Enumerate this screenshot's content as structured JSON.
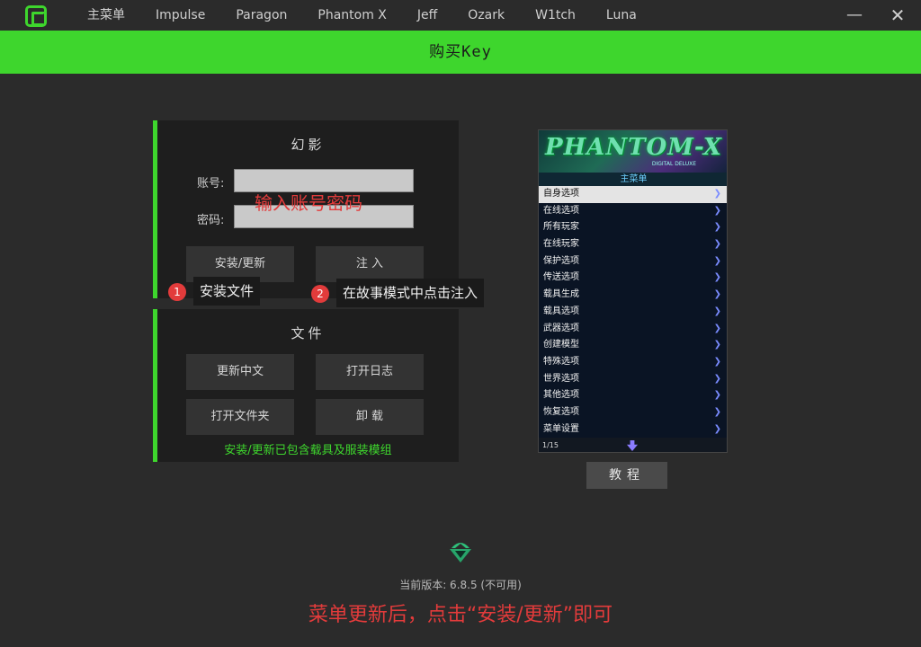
{
  "nav": {
    "items": [
      "主菜单",
      "Impulse",
      "Paragon",
      "Phantom X",
      "Jeff",
      "Ozark",
      "W1tch",
      "Luna"
    ]
  },
  "window": {
    "minimize": "—",
    "close": "✕"
  },
  "buy_bar": {
    "label": "购买Key"
  },
  "login_panel": {
    "title": "幻影",
    "account_label": "账号:",
    "password_label": "密码:",
    "account_value": "",
    "password_value": "",
    "overlay_hint": "输入账号密码",
    "install_button": "安装/更新",
    "inject_button": "注 入"
  },
  "tips": [
    {
      "num": "1",
      "text": "安装文件"
    },
    {
      "num": "2",
      "text": "在故事模式中点击注入"
    }
  ],
  "files_panel": {
    "title": "文件",
    "update_cn_button": "更新中文",
    "open_log_button": "打开日志",
    "open_folder_button": "打开文件夹",
    "uninstall_button": "卸 载",
    "note": "安装/更新已包含载具及服装模组"
  },
  "preview": {
    "brand": "PHANTOM-X",
    "sub": "DIGITAL DELUXE",
    "header": "主菜单",
    "items": [
      "自身选项",
      "在线选项",
      "所有玩家",
      "在线玩家",
      "保护选项",
      "传送选项",
      "载具生成",
      "载具选项",
      "武器选项",
      "创建模型",
      "特殊选项",
      "世界选项",
      "其他选项",
      "恢复选项",
      "菜单设置"
    ],
    "active_index": 0,
    "page": "1/15",
    "arrow_icon": "chevron-right-icon"
  },
  "tutorial_button": "教程",
  "version": "当前版本: 6.8.5 (不可用)",
  "notice": "菜单更新后，点击“安装/更新”即可",
  "colors": {
    "accent": "#3ed62d",
    "warning": "#e23b3b",
    "background": "#2b2b2b"
  }
}
